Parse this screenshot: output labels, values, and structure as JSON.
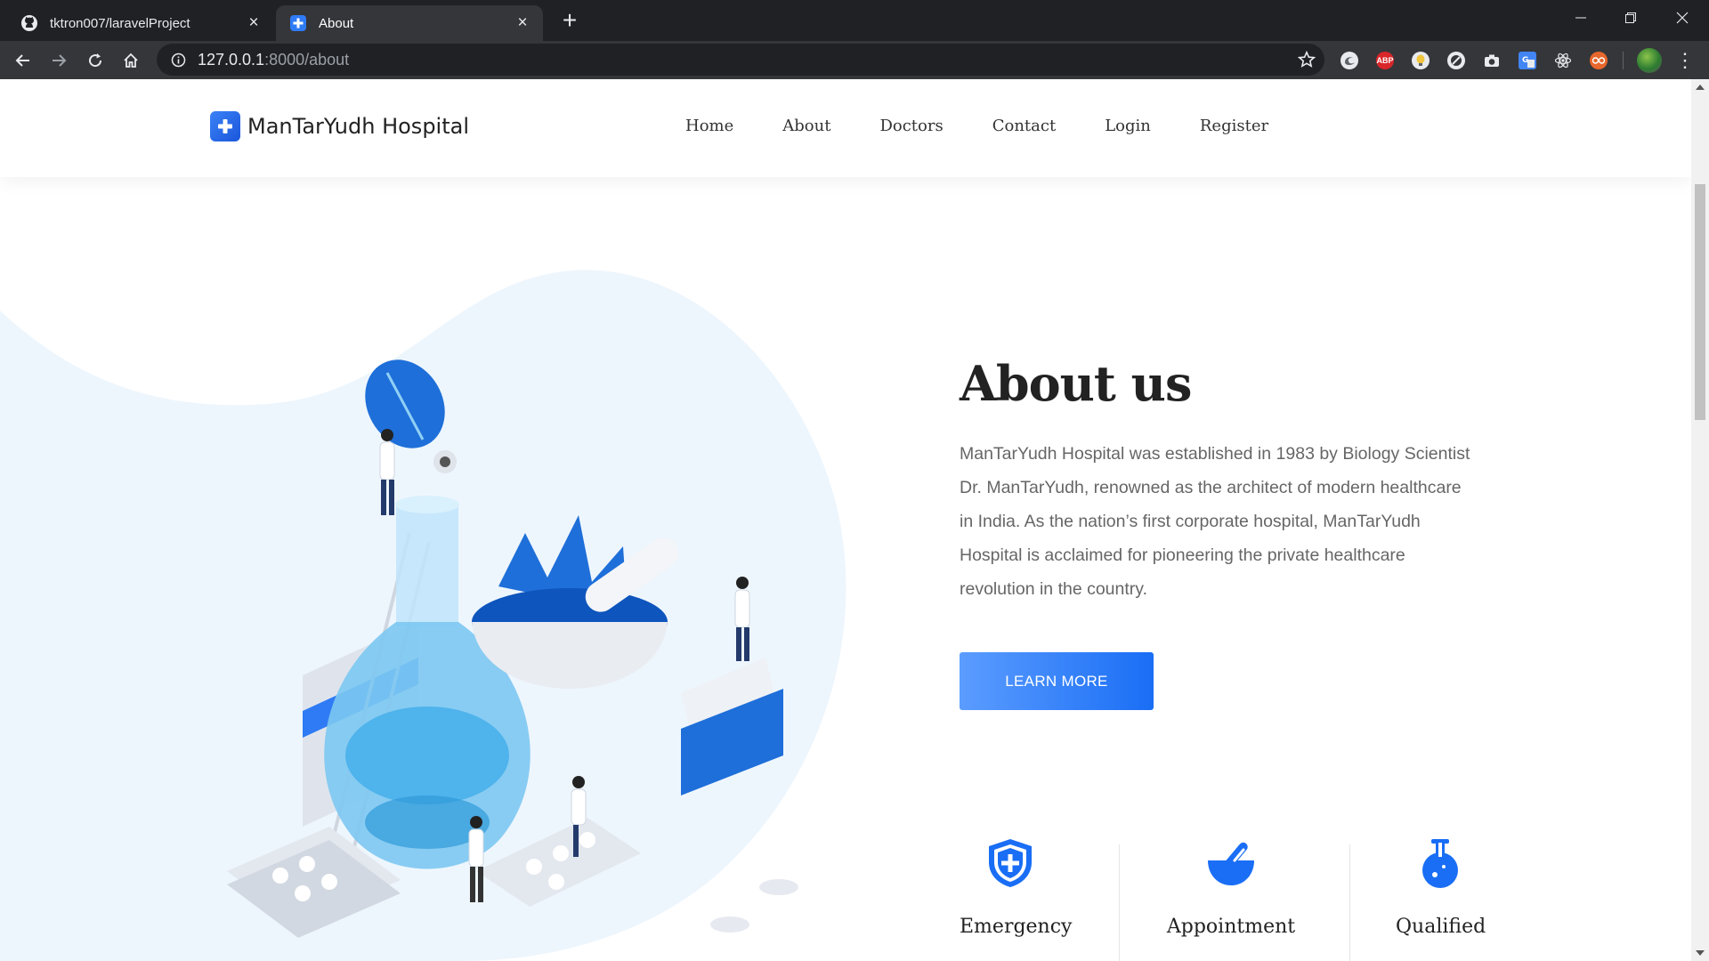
{
  "browser": {
    "tabs": [
      {
        "title": "tktron007/laravelProject",
        "icon": "github-icon",
        "active": false
      },
      {
        "title": "About",
        "icon": "hospital-plus-icon",
        "active": true
      }
    ],
    "url_host": "127.0.0.1",
    "url_path": ":8000/about",
    "extensions": [
      "edge-extension-icon",
      "adblock-plus-icon",
      "bulb-extension-icon",
      "block-extension-icon",
      "camera-extension-icon",
      "translate-extension-icon",
      "react-devtools-icon",
      "glasses-extension-icon"
    ],
    "adblock_label": "ABP"
  },
  "site": {
    "brand_name": "ManTarYudh Hospital",
    "nav": [
      "Home",
      "About",
      "Doctors",
      "Contact",
      "Login",
      "Register"
    ]
  },
  "about": {
    "title": "About us",
    "paragraph": "ManTarYudh Hospital was established in 1983 by Biology Scientist Dr. ManTarYudh, renowned as the architect of modern healthcare in India. As the nation’s first corporate hospital, ManTarYudh Hospital is acclaimed for pioneering the private healthcare revolution in the country.",
    "cta_label": "LEARN MORE"
  },
  "features": [
    {
      "label": "Emergency",
      "icon": "shield-plus-icon"
    },
    {
      "label": "Appointment",
      "icon": "mortar-pestle-icon"
    },
    {
      "label": "Qualified",
      "icon": "flask-icon"
    }
  ],
  "colors": {
    "accent": "#1a6ef5",
    "accent_light": "#5b9cff",
    "blob": "#eef6fd",
    "chrome_dark": "#202124",
    "chrome_toolbar": "#35363a"
  }
}
